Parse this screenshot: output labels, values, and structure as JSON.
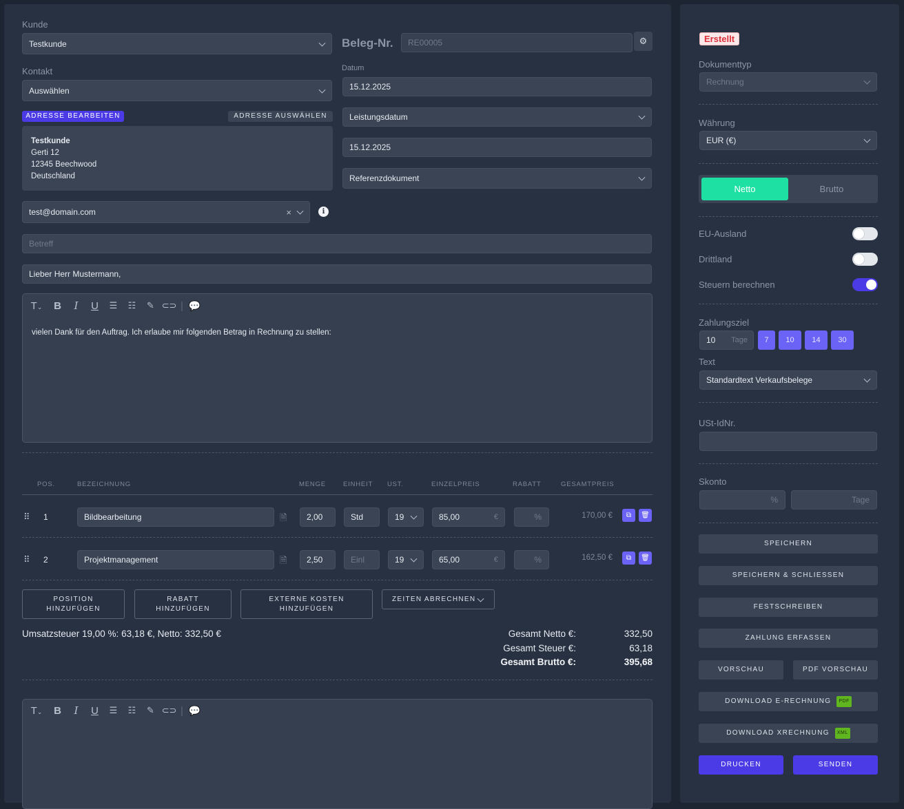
{
  "customer": {
    "label": "Kunde",
    "value": "Testkunde"
  },
  "contact": {
    "label": "Kontakt",
    "value": "Auswählen"
  },
  "address": {
    "edit_button": "ADRESSE BEARBEITEN",
    "select_button": "ADRESSE AUSWÄHLEN",
    "lines": [
      "Testkunde",
      "Gerti 12",
      "12345 Beechwood",
      "Deutschland"
    ]
  },
  "email": {
    "value": "test@domain.com"
  },
  "doc_number": {
    "label": "Beleg-Nr.",
    "placeholder": "RE00005"
  },
  "date": {
    "label": "Datum",
    "value": "15.12.2025"
  },
  "service_date": {
    "value": "Leistungsdatum",
    "date_value": "15.12.2025"
  },
  "reference": {
    "value": "Referenzdokument"
  },
  "subject": {
    "placeholder": "Betreff"
  },
  "salutation": {
    "value": "Lieber Herr Mustermann,"
  },
  "intro_text": "vielen Dank für den Auftrag. Ich erlaube mir folgenden Betrag in Rechnung zu stellen:",
  "table": {
    "headers": [
      "POS.",
      "BEZEICHNUNG",
      "MENGE",
      "EINHEIT",
      "UST.",
      "EINZELPREIS",
      "RABATT",
      "GESAMTPREIS"
    ],
    "rows": [
      {
        "pos": "1",
        "name": "Bildbearbeitung",
        "qty": "2,00",
        "unit": "Std",
        "vat": "19",
        "price": "85,00",
        "currency": "€",
        "discount": "%",
        "total": "170,00 €"
      },
      {
        "pos": "2",
        "name": "Projektmanagement",
        "qty": "2,50",
        "unit": "Einl",
        "vat": "19",
        "price": "65,00",
        "currency": "€",
        "discount": "%",
        "total": "162,50 €"
      }
    ]
  },
  "actions": {
    "add_position": "POSITION HINZUFÜGEN",
    "add_discount": "RABATT HINZUFÜGEN",
    "add_external": "EXTERNE KOSTEN HINZUFÜGEN",
    "bill_times": "ZEITEN ABRECHNEN"
  },
  "totals": {
    "vat_summary": "Umsatzsteuer 19,00 %: 63,18 €, Netto: 332,50 €",
    "net_label": "Gesamt Netto €:",
    "net_value": "332,50",
    "tax_label": "Gesamt Steuer €:",
    "tax_value": "63,18",
    "gross_label": "Gesamt Brutto €:",
    "gross_value": "395,68"
  },
  "sidebar": {
    "status": "Erstellt",
    "doc_type_label": "Dokumenttyp",
    "doc_type_value": "Rechnung",
    "currency_label": "Währung",
    "currency_value": "EUR (€)",
    "net_tab": "Netto",
    "gross_tab": "Brutto",
    "eu_label": "EU-Ausland",
    "third_country_label": "Drittland",
    "calc_tax_label": "Steuern berechnen",
    "toggles": {
      "eu": false,
      "third_country": false,
      "calc_tax": true
    },
    "payment_term_label": "Zahlungsziel",
    "payment_term_value": "10",
    "payment_term_unit": "Tage",
    "payment_chips": [
      "7",
      "10",
      "14",
      "30"
    ],
    "text_label": "Text",
    "text_value": "Standardtext Verkaufsbelege",
    "vat_id_label": "USt-IdNr.",
    "discount_label": "Skonto",
    "discount_percent_ph": "%",
    "discount_days_ph": "Tage",
    "buttons": {
      "save": "SPEICHERN",
      "save_close": "SPEICHERN & SCHLIESSEN",
      "finalize": "FESTSCHREIBEN",
      "record_payment": "ZAHLUNG ERFASSEN",
      "preview": "VORSCHAU",
      "pdf_preview": "PDF VORSCHAU",
      "download_einvoice": "DOWNLOAD E-RECHNUNG",
      "download_einvoice_tag": "PDF",
      "download_xinvoice": "DOWNLOAD XRECHNUNG",
      "download_xinvoice_tag": "XML",
      "print": "DRUCKEN",
      "send": "SENDEN"
    }
  },
  "colors": {
    "accent": "#4b3be6",
    "toggle_active": "#1fe0a3",
    "status": "#d9303a"
  }
}
